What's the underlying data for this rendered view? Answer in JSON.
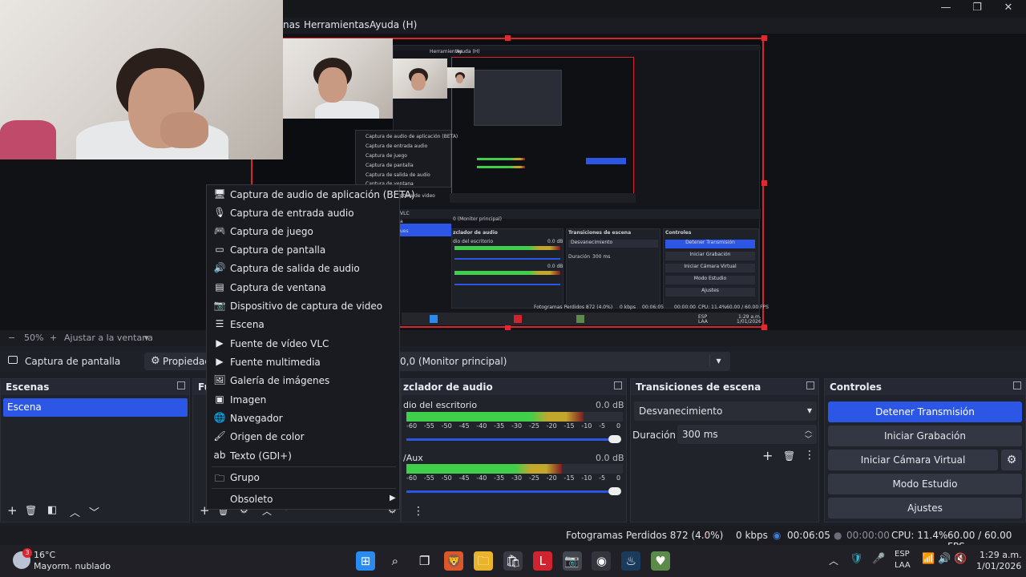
{
  "menu": {
    "items": [
      "nas",
      "Herramientas",
      "Ayuda (H)"
    ]
  },
  "window_controls": {
    "minimize": "—",
    "maximize": "❐",
    "close": "✕"
  },
  "nested_preview": {
    "menu": [
      "Herramientas",
      "Ayuda (H)"
    ],
    "source_list": [
      "Captura de audio de aplicación (BETA)",
      "Captura de entrada audio",
      "Captura de juego",
      "Captura de pantalla",
      "Captura de salida de audio",
      "Captura de ventana"
    ],
    "source_partial": [
      "ptura de video",
      "VLC",
      "a",
      "ues"
    ],
    "monitor": "0 (Monitor principal)",
    "mixer_title": "zclador de audio",
    "mixer_ch1": "dio del escritorio",
    "mixer_ch1_db": "0.0 dB",
    "mixer_ch2_db": "0.0 dB",
    "transitions_title": "Transiciones de escena",
    "transition": "Desvanecimiento",
    "duration_label": "Duración",
    "duration": "300 ms",
    "controls_title": "Controles",
    "controls": [
      "Detener Transmisión",
      "Iniciar Grabación",
      "Iniciar Cámara Virtual",
      "Modo Estudio",
      "Ajustes"
    ],
    "status": [
      "Fotogramas Perdidos 872 (4.0%)",
      "0 kbps",
      "00:06:05",
      "00:00:00",
      "CPU: 11.4%",
      "60.00 / 60.00 FPS"
    ],
    "taskbar_lang": [
      "ESP",
      "LAA"
    ],
    "taskbar_time": [
      "1:29 a.m.",
      "1/01/2026"
    ]
  },
  "zoom": {
    "minus": "−",
    "value": "50%",
    "plus": "+",
    "fit": "Ajustar a la ventana",
    "dropdown": "▾"
  },
  "source_bar": {
    "selected_source": "Captura de pantalla",
    "properties": "Propiedad",
    "display": "0,0 (Monitor principal)",
    "dropdown": "▾"
  },
  "scenes": {
    "title": "Escenas",
    "items": [
      "Escena"
    ],
    "toolbar": [
      "+",
      "🗑",
      "◧",
      "︿",
      "﹀"
    ]
  },
  "sources_panel": {
    "title_partial": "Fu",
    "toolbar": [
      "+",
      "🗑",
      "⚙",
      "︿",
      "﹀"
    ]
  },
  "mixer": {
    "title": "zclador de audio",
    "channels": [
      {
        "name": "dio del escritorio",
        "db": "0.0 dB",
        "level": 0.82
      },
      {
        "name": "/Aux",
        "db": "0.0 dB",
        "level": 0.72
      }
    ],
    "scale": [
      "-60",
      "-55",
      "-50",
      "-45",
      "-40",
      "-35",
      "-30",
      "-25",
      "-20",
      "-15",
      "-10",
      "-5",
      "0"
    ],
    "menu_icon": "⋮"
  },
  "transitions": {
    "title": "Transiciones de escena",
    "selected": "Desvanecimiento",
    "duration_label": "Duración",
    "duration": "300 ms",
    "add": "+",
    "remove": "🗑",
    "more": "⋮"
  },
  "controls": {
    "title": "Controles",
    "buttons": [
      "Detener Transmisión",
      "Iniciar Grabación",
      "Iniciar Cámara Virtual",
      "Modo Estudio",
      "Ajustes"
    ],
    "gear": "⚙"
  },
  "status": {
    "dropped": "Fotogramas Perdidos 872 (4.0%)",
    "kbps": "0 kbps",
    "stream_time": "00:06:05",
    "rec_time": "00:00:00",
    "cpu": "CPU: 11.4%",
    "fps": "60.00 / 60.00 FPS"
  },
  "context_menu": {
    "items": [
      {
        "label": "Captura de audio de aplicación (BETA)",
        "icon": "🖥"
      },
      {
        "label": "Captura de entrada audio",
        "icon": "🎙"
      },
      {
        "label": "Captura de juego",
        "icon": "🎮"
      },
      {
        "label": "Captura de pantalla",
        "icon": "▭"
      },
      {
        "label": "Captura de salida de audio",
        "icon": "🔊"
      },
      {
        "label": "Captura de ventana",
        "icon": "▤"
      },
      {
        "label": "Dispositivo de captura de video",
        "icon": "📷"
      },
      {
        "label": "Escena",
        "icon": "☰"
      },
      {
        "label": "Fuente de vídeo VLC",
        "icon": "▶"
      },
      {
        "label": "Fuente multimedia",
        "icon": "▶"
      },
      {
        "label": "Galería de imágenes",
        "icon": "🖼"
      },
      {
        "label": "Imagen",
        "icon": "▣"
      },
      {
        "label": "Navegador",
        "icon": "🌐"
      },
      {
        "label": "Origen de color",
        "icon": "🖌"
      },
      {
        "label": "Texto (GDI+)",
        "icon": "ab"
      },
      {
        "label": "Grupo",
        "icon": "🗀"
      },
      {
        "label": "Obsoleto",
        "icon": ""
      }
    ],
    "submenu_arrow": "▶"
  },
  "taskbar": {
    "weather_temp": "16°C",
    "weather_desc": "Mayorm. nublado",
    "weather_badge": "3",
    "lang1": "ESP",
    "lang2": "LAA",
    "time": "1:29 a.m.",
    "date": "1/01/2026",
    "tray": [
      "︿",
      "🛡",
      "🎤",
      "📶",
      "🔊",
      "🔇"
    ],
    "apps": [
      {
        "name": "start-icon",
        "glyph": "⊞",
        "color": "#2b8af0"
      },
      {
        "name": "search-icon",
        "glyph": "⌕",
        "color": "#202026"
      },
      {
        "name": "task-view-icon",
        "glyph": "❐",
        "color": "#202026"
      },
      {
        "name": "brave-browser-icon",
        "glyph": "🦁",
        "color": "#e0562b"
      },
      {
        "name": "file-explorer-icon",
        "glyph": "🗀",
        "color": "#e9b32a"
      },
      {
        "name": "store-icon",
        "glyph": "🛍",
        "color": "#3a3a44"
      },
      {
        "name": "app-l-icon",
        "glyph": "L",
        "color": "#cf2430"
      },
      {
        "name": "camera-icon",
        "glyph": "📷",
        "color": "#44464f"
      },
      {
        "name": "obs-icon",
        "glyph": "◉",
        "color": "#33343c"
      },
      {
        "name": "steam-icon",
        "glyph": "♨",
        "color": "#1a3b5c"
      },
      {
        "name": "app-heart-icon",
        "glyph": "♥",
        "color": "#5b8a4a"
      }
    ]
  }
}
